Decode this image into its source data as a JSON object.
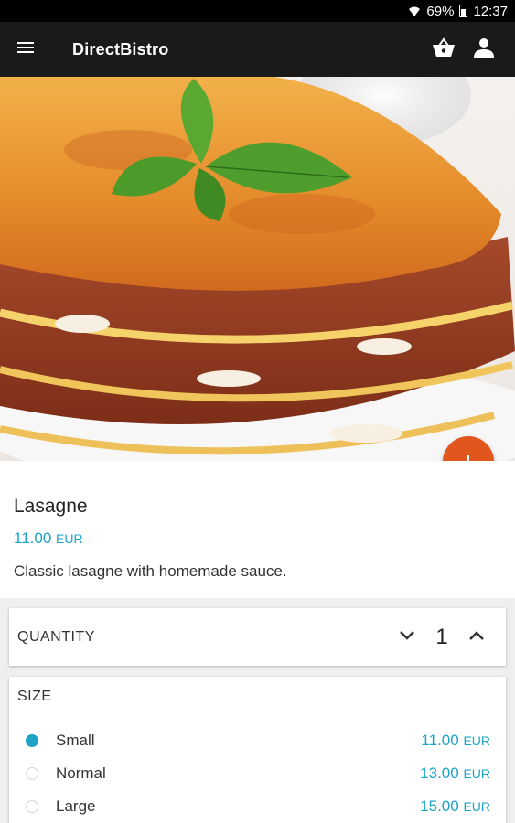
{
  "status_bar": {
    "battery": "69%",
    "time": "12:37",
    "wifi_icon": "wifi-icon",
    "battery_icon": "battery-icon"
  },
  "app_bar": {
    "title": "DirectBistro",
    "menu_icon": "menu-icon",
    "basket_icon": "basket-icon",
    "account_icon": "account-icon"
  },
  "hero": {
    "image": "lasagne-photo"
  },
  "fab": {
    "icon": "plus-icon",
    "label": "+"
  },
  "dish": {
    "name": "Lasagne",
    "price": "11.00",
    "currency": "EUR",
    "description": "Classic lasagne with homemade sauce."
  },
  "quantity": {
    "label": "QUANTITY",
    "value": "1"
  },
  "size": {
    "label": "SIZE",
    "options": [
      {
        "name": "Small",
        "price": "11.00",
        "currency": "EUR",
        "selected": true
      },
      {
        "name": "Normal",
        "price": "13.00",
        "currency": "EUR",
        "selected": false
      },
      {
        "name": "Large",
        "price": "15.00",
        "currency": "EUR",
        "selected": false
      }
    ]
  },
  "colors": {
    "accent": "#1ea3c4",
    "fab": "#e0561d",
    "app_bar": "#1a1a1a"
  }
}
